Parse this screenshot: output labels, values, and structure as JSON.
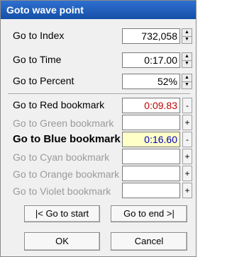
{
  "window": {
    "title": "Goto wave point"
  },
  "rows": {
    "index": {
      "label": "Go to Index",
      "value": "732,058"
    },
    "time": {
      "label": "Go to Time",
      "value": "0:17.00"
    },
    "percent": {
      "label": "Go to Percent",
      "value": "52%"
    }
  },
  "bookmarks": {
    "red": {
      "label": "Go to Red bookmark",
      "value": "0:09.83",
      "button": "-"
    },
    "green": {
      "label": "Go to Green bookmark",
      "value": "",
      "button": "+"
    },
    "blue": {
      "label": "Go to Blue bookmark",
      "value": "0:16.60",
      "button": "-"
    },
    "cyan": {
      "label": "Go to Cyan bookmark",
      "value": "",
      "button": "+"
    },
    "orange": {
      "label": "Go to Orange bookmark",
      "value": "",
      "button": "+"
    },
    "violet": {
      "label": "Go to Violet bookmark",
      "value": "",
      "button": "+"
    }
  },
  "buttons": {
    "go_start": "|< Go to start",
    "go_end": "Go to end >|",
    "ok": "OK",
    "cancel": "Cancel"
  },
  "colors": {
    "title_bar": "#1450a8",
    "red_value": "#c00000",
    "blue_value": "#0000c0",
    "blue_highlight": "#ffffc8"
  },
  "icons": {
    "spin_up": "▲",
    "spin_down": "▼"
  }
}
